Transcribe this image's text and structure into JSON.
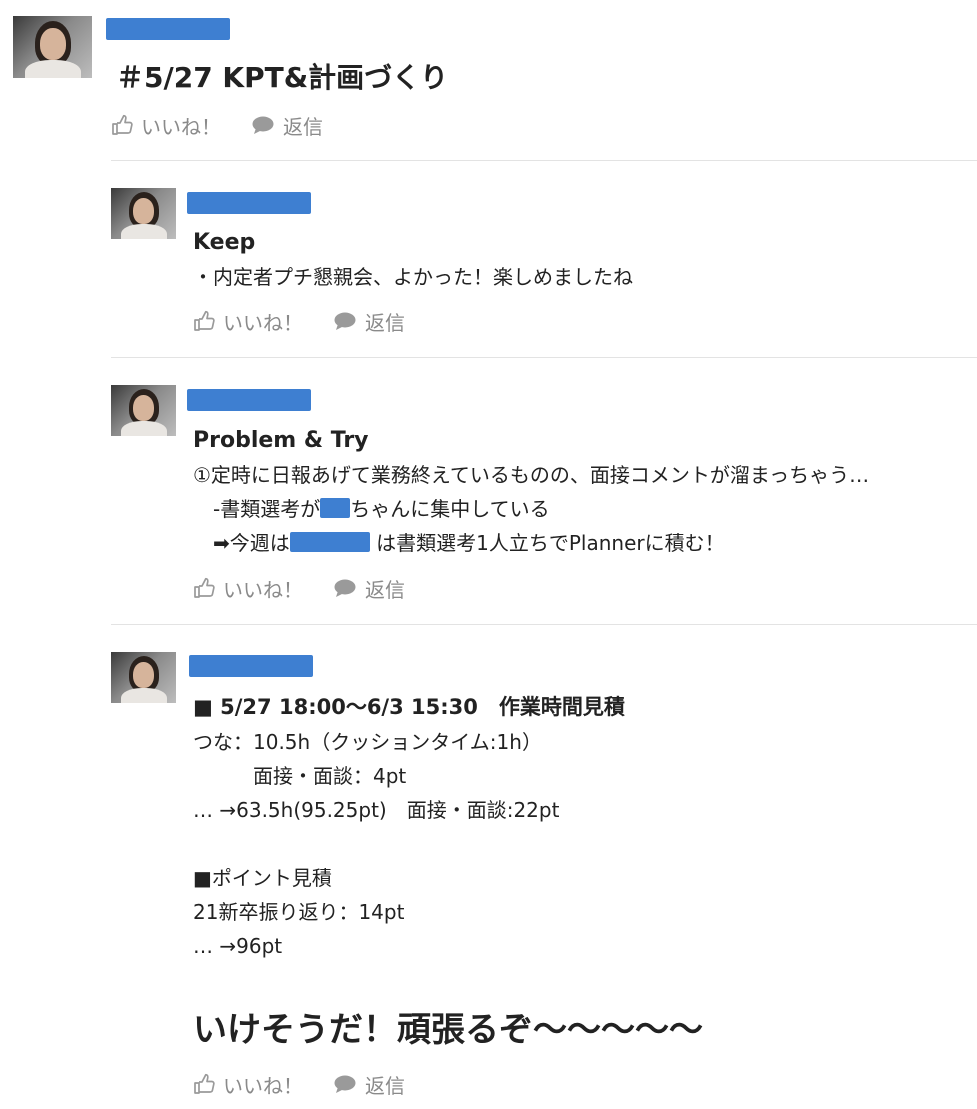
{
  "actions": {
    "like_label": "いいね！",
    "reply_label": "返信"
  },
  "thread": {
    "title": "＃5/27 KPT&計画づくり"
  },
  "replies": [
    {
      "heading": "Keep",
      "lines": [
        "・内定者プチ懇親会、よかった！楽しめましたね"
      ]
    },
    {
      "heading": "Problem & Try",
      "lines": [
        "①定時に日報あげて業務終えているものの、面接コメントが溜まっちゃう…",
        {
          "pre": "　-書類選考が",
          "post": "ちゃんに集中している"
        },
        {
          "pre": "　➡今週は",
          "post": " は書類選考1人立ちでPlannerに積む！"
        }
      ]
    },
    {
      "heading": "■ 5/27 18:00〜6/3 15:30　作業時間見積",
      "lines": [
        "つな：10.5h（クッションタイム:1h）",
        "　　　面接・面談：4pt",
        "… →63.5h(95.25pt)　面接・面談:22pt",
        "",
        "■ポイント見積",
        "21新卒振り返り：14pt",
        "… →96pt"
      ],
      "closing": "いけそうだ！頑張るぞ〜〜〜〜〜"
    }
  ]
}
